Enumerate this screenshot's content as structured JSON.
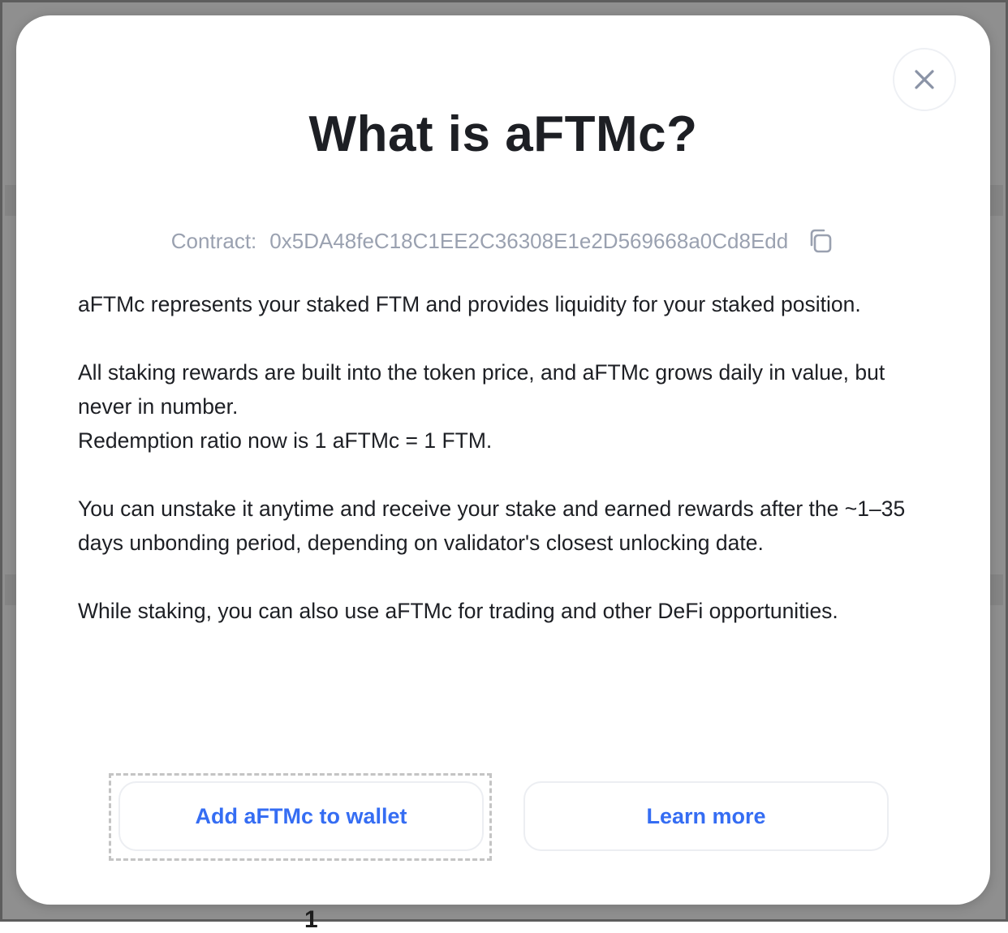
{
  "modal": {
    "title": "What is aFTMc?",
    "contract_label": "Contract:",
    "contract_address": "0x5DA48feC18C1EE2C36308E1e2D569668a0Cd8Edd",
    "paragraphs": [
      "aFTMc represents your staked FTM and provides liquidity for your staked position.",
      "All staking rewards are built into the token price, and aFTMc grows daily in value, but never in number.",
      "Redemption ratio now is 1 aFTMc = 1 FTM.",
      "You can unstake it anytime and receive your stake and earned rewards after the ~1–35 days unbonding period, depending on validator's closest unlocking date.",
      "While staking, you can also use aFTMc for trading and other DeFi opportunities."
    ],
    "buttons": {
      "add_to_wallet": "Add aFTMc to wallet",
      "learn_more": "Learn more"
    },
    "icons": {
      "close": "close-icon",
      "copy": "copy-icon"
    }
  },
  "background": {
    "partial_glyph": "1"
  },
  "colors": {
    "accent": "#356df3",
    "text": "#1d1f24",
    "muted": "#9aa1b0",
    "overlay": "#8f8f8f"
  }
}
